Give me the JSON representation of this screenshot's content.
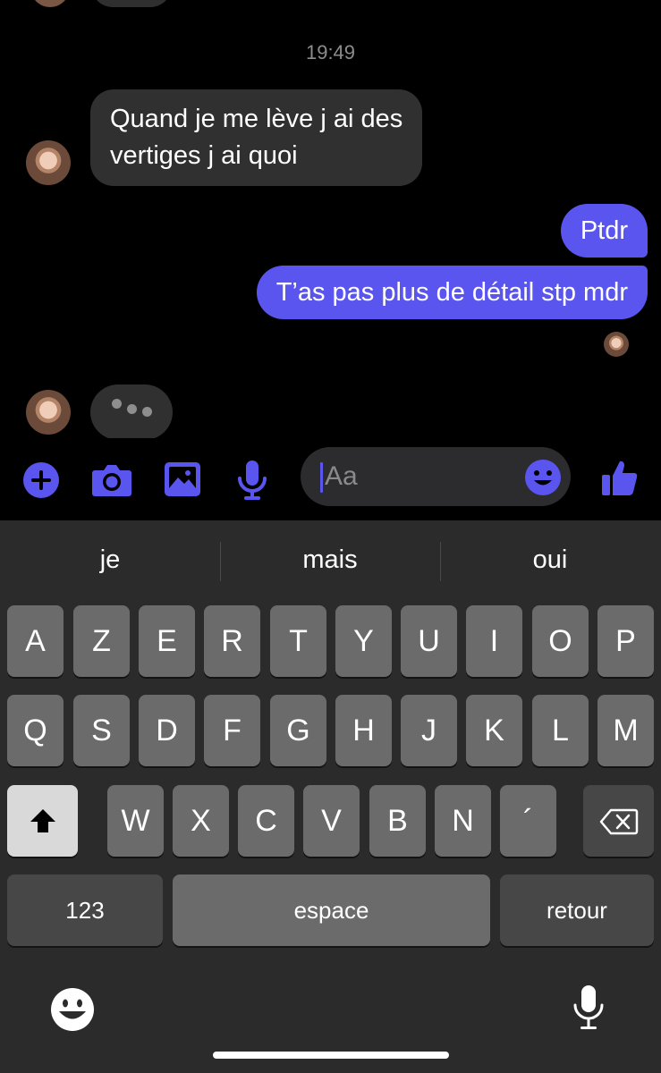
{
  "chat": {
    "timestamp": "19:49",
    "messages": [
      {
        "direction": "incoming",
        "lines": [
          "Quand je me lève j ai des",
          "vertiges j ai quoi"
        ]
      },
      {
        "direction": "outgoing",
        "text": "Ptdr"
      },
      {
        "direction": "outgoing",
        "text": "T’as pas plus de détail stp mdr"
      }
    ],
    "typing_indicator": true
  },
  "composer": {
    "placeholder": "Aa",
    "icons": [
      "plus-icon",
      "camera-icon",
      "image-icon",
      "microphone-icon",
      "emoji-icon",
      "thumbs-up-icon"
    ],
    "accent_color": "#5b55f0"
  },
  "keyboard": {
    "suggestions": [
      "je",
      "mais",
      "oui"
    ],
    "row1": [
      "A",
      "Z",
      "E",
      "R",
      "T",
      "Y",
      "U",
      "I",
      "O",
      "P"
    ],
    "row2": [
      "Q",
      "S",
      "D",
      "F",
      "G",
      "H",
      "J",
      "K",
      "L",
      "M"
    ],
    "row3": [
      "W",
      "X",
      "C",
      "V",
      "B",
      "N",
      "´"
    ],
    "numbers_label": "123",
    "space_label": "espace",
    "return_label": "retour"
  }
}
